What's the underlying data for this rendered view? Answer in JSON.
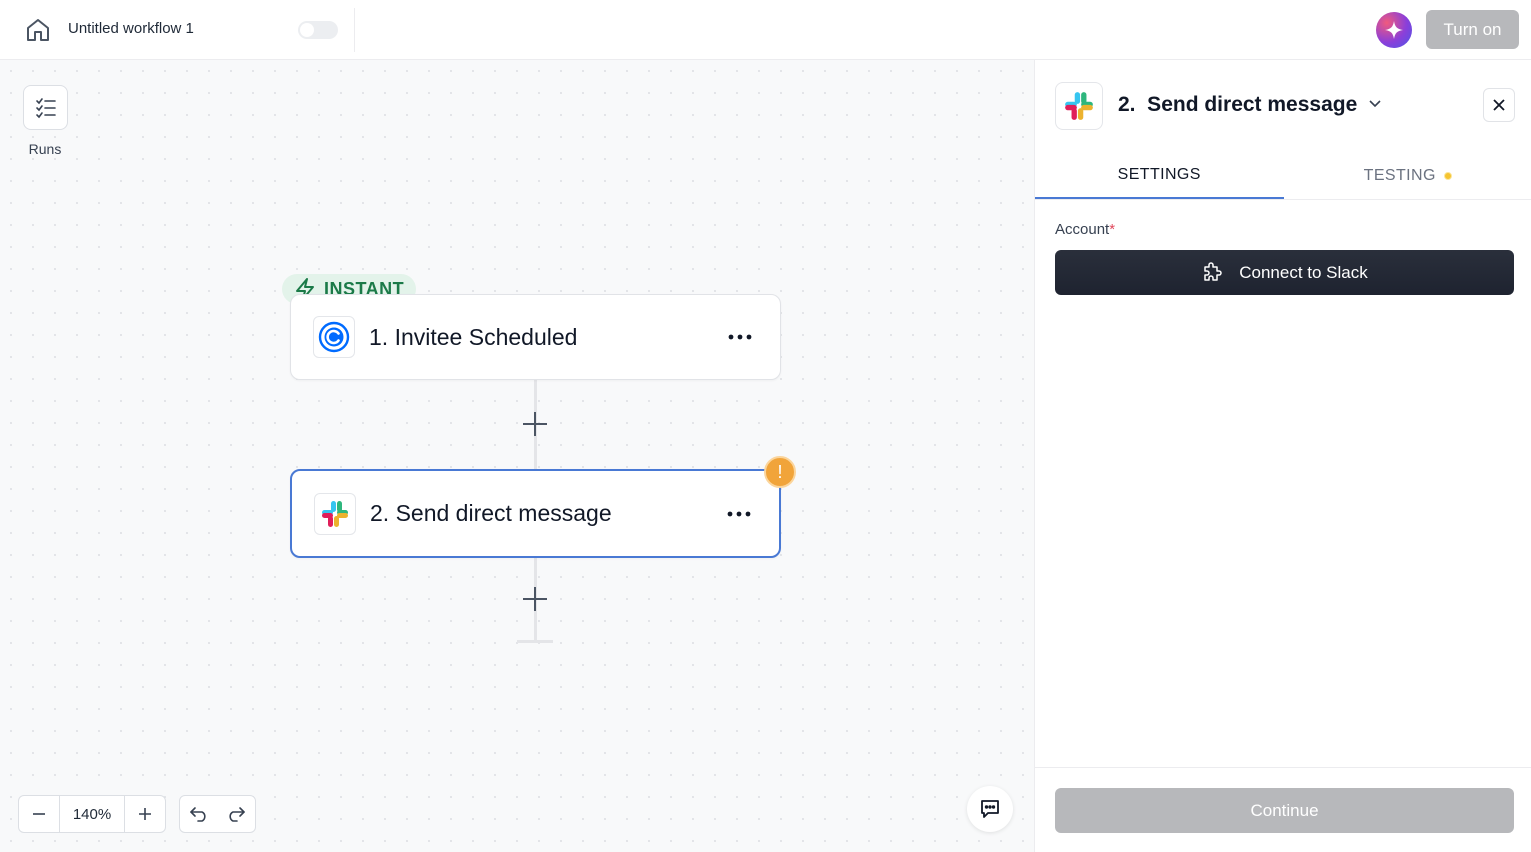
{
  "header": {
    "home_icon": "home-icon",
    "workflow_title": "Untitled workflow 1",
    "publish_toggle": "off",
    "ai_icon": "sparkle-icon",
    "turn_on_label": "Turn on"
  },
  "canvas": {
    "runs_icon": "checklist-icon",
    "runs_label": "Runs",
    "trigger_badge": "INSTANT",
    "steps": [
      {
        "label": "1. Invitee Scheduled",
        "app_icon": "calendly-icon",
        "more": "···"
      },
      {
        "label": "2. Send direct message",
        "app_icon": "slack-icon",
        "more": "···",
        "warning": "!"
      }
    ],
    "add_step": "+",
    "zoom": {
      "minus": "−",
      "value": "140%",
      "plus": "+"
    },
    "undo_icon": "undo-icon",
    "redo_icon": "redo-icon",
    "chat_icon": "chat-icon"
  },
  "panel": {
    "title": "2.  Send direct message",
    "app_icon": "slack-icon",
    "tabs": [
      {
        "label": "SETTINGS",
        "active": true
      },
      {
        "label": "TESTING",
        "active": false,
        "status_dot": "#f5c431"
      }
    ],
    "account_label": "Account",
    "required_mark": "*",
    "connect_label": "Connect to Slack",
    "continue_label": "Continue"
  },
  "colors": {
    "accent_blue": "#4979d4",
    "warning": "#f1a43a",
    "instant_green": "#1b7a48",
    "dark_button": "#1e2330",
    "disabled": "#b7b8bb"
  }
}
